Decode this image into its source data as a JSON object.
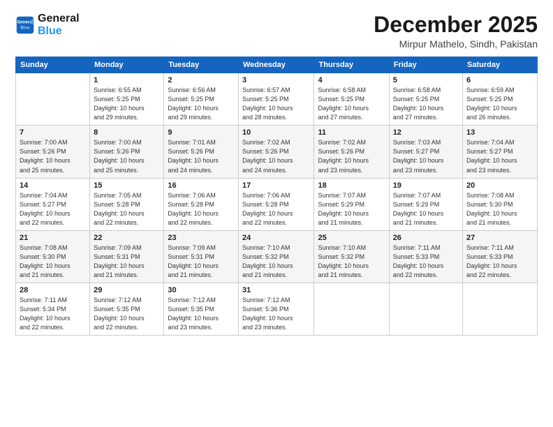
{
  "header": {
    "logo_line1": "General",
    "logo_line2": "Blue",
    "month": "December 2025",
    "location": "Mirpur Mathelo, Sindh, Pakistan"
  },
  "weekdays": [
    "Sunday",
    "Monday",
    "Tuesday",
    "Wednesday",
    "Thursday",
    "Friday",
    "Saturday"
  ],
  "weeks": [
    [
      {
        "day": "",
        "info": ""
      },
      {
        "day": "1",
        "info": "Sunrise: 6:55 AM\nSunset: 5:25 PM\nDaylight: 10 hours\nand 29 minutes."
      },
      {
        "day": "2",
        "info": "Sunrise: 6:56 AM\nSunset: 5:25 PM\nDaylight: 10 hours\nand 29 minutes."
      },
      {
        "day": "3",
        "info": "Sunrise: 6:57 AM\nSunset: 5:25 PM\nDaylight: 10 hours\nand 28 minutes."
      },
      {
        "day": "4",
        "info": "Sunrise: 6:58 AM\nSunset: 5:25 PM\nDaylight: 10 hours\nand 27 minutes."
      },
      {
        "day": "5",
        "info": "Sunrise: 6:58 AM\nSunset: 5:25 PM\nDaylight: 10 hours\nand 27 minutes."
      },
      {
        "day": "6",
        "info": "Sunrise: 6:59 AM\nSunset: 5:25 PM\nDaylight: 10 hours\nand 26 minutes."
      }
    ],
    [
      {
        "day": "7",
        "info": "Sunrise: 7:00 AM\nSunset: 5:26 PM\nDaylight: 10 hours\nand 25 minutes."
      },
      {
        "day": "8",
        "info": "Sunrise: 7:00 AM\nSunset: 5:26 PM\nDaylight: 10 hours\nand 25 minutes."
      },
      {
        "day": "9",
        "info": "Sunrise: 7:01 AM\nSunset: 5:26 PM\nDaylight: 10 hours\nand 24 minutes."
      },
      {
        "day": "10",
        "info": "Sunrise: 7:02 AM\nSunset: 5:26 PM\nDaylight: 10 hours\nand 24 minutes."
      },
      {
        "day": "11",
        "info": "Sunrise: 7:02 AM\nSunset: 5:26 PM\nDaylight: 10 hours\nand 23 minutes."
      },
      {
        "day": "12",
        "info": "Sunrise: 7:03 AM\nSunset: 5:27 PM\nDaylight: 10 hours\nand 23 minutes."
      },
      {
        "day": "13",
        "info": "Sunrise: 7:04 AM\nSunset: 5:27 PM\nDaylight: 10 hours\nand 23 minutes."
      }
    ],
    [
      {
        "day": "14",
        "info": "Sunrise: 7:04 AM\nSunset: 5:27 PM\nDaylight: 10 hours\nand 22 minutes."
      },
      {
        "day": "15",
        "info": "Sunrise: 7:05 AM\nSunset: 5:28 PM\nDaylight: 10 hours\nand 22 minutes."
      },
      {
        "day": "16",
        "info": "Sunrise: 7:06 AM\nSunset: 5:28 PM\nDaylight: 10 hours\nand 22 minutes."
      },
      {
        "day": "17",
        "info": "Sunrise: 7:06 AM\nSunset: 5:28 PM\nDaylight: 10 hours\nand 22 minutes."
      },
      {
        "day": "18",
        "info": "Sunrise: 7:07 AM\nSunset: 5:29 PM\nDaylight: 10 hours\nand 21 minutes."
      },
      {
        "day": "19",
        "info": "Sunrise: 7:07 AM\nSunset: 5:29 PM\nDaylight: 10 hours\nand 21 minutes."
      },
      {
        "day": "20",
        "info": "Sunrise: 7:08 AM\nSunset: 5:30 PM\nDaylight: 10 hours\nand 21 minutes."
      }
    ],
    [
      {
        "day": "21",
        "info": "Sunrise: 7:08 AM\nSunset: 5:30 PM\nDaylight: 10 hours\nand 21 minutes."
      },
      {
        "day": "22",
        "info": "Sunrise: 7:09 AM\nSunset: 5:31 PM\nDaylight: 10 hours\nand 21 minutes."
      },
      {
        "day": "23",
        "info": "Sunrise: 7:09 AM\nSunset: 5:31 PM\nDaylight: 10 hours\nand 21 minutes."
      },
      {
        "day": "24",
        "info": "Sunrise: 7:10 AM\nSunset: 5:32 PM\nDaylight: 10 hours\nand 21 minutes."
      },
      {
        "day": "25",
        "info": "Sunrise: 7:10 AM\nSunset: 5:32 PM\nDaylight: 10 hours\nand 21 minutes."
      },
      {
        "day": "26",
        "info": "Sunrise: 7:11 AM\nSunset: 5:33 PM\nDaylight: 10 hours\nand 22 minutes."
      },
      {
        "day": "27",
        "info": "Sunrise: 7:11 AM\nSunset: 5:33 PM\nDaylight: 10 hours\nand 22 minutes."
      }
    ],
    [
      {
        "day": "28",
        "info": "Sunrise: 7:11 AM\nSunset: 5:34 PM\nDaylight: 10 hours\nand 22 minutes."
      },
      {
        "day": "29",
        "info": "Sunrise: 7:12 AM\nSunset: 5:35 PM\nDaylight: 10 hours\nand 22 minutes."
      },
      {
        "day": "30",
        "info": "Sunrise: 7:12 AM\nSunset: 5:35 PM\nDaylight: 10 hours\nand 23 minutes."
      },
      {
        "day": "31",
        "info": "Sunrise: 7:12 AM\nSunset: 5:36 PM\nDaylight: 10 hours\nand 23 minutes."
      },
      {
        "day": "",
        "info": ""
      },
      {
        "day": "",
        "info": ""
      },
      {
        "day": "",
        "info": ""
      }
    ]
  ]
}
